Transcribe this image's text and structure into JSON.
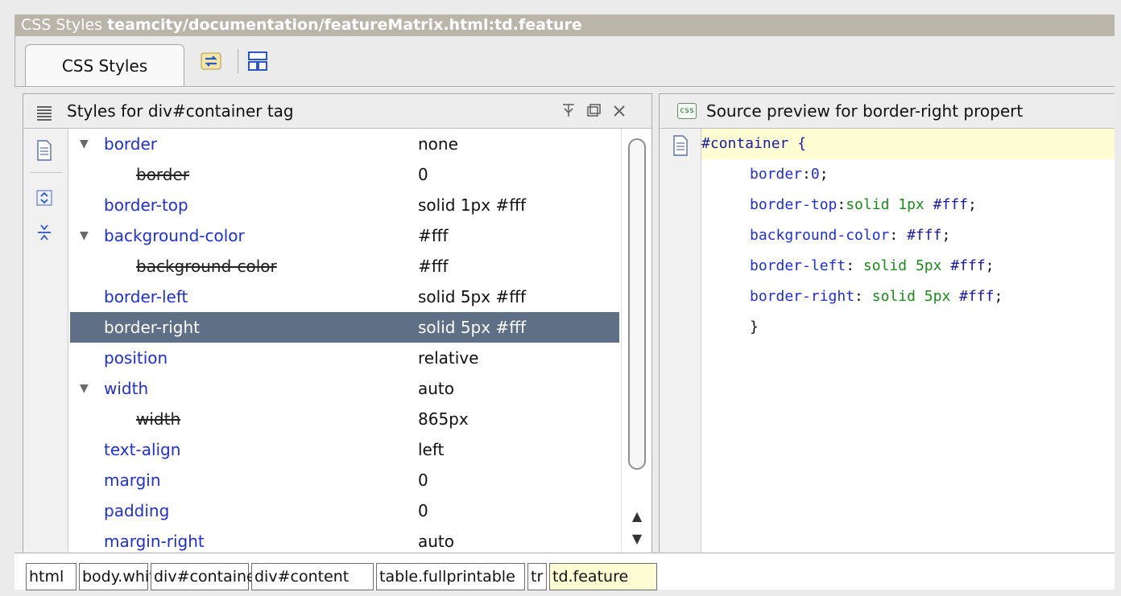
{
  "window": {
    "title_prefix": "CSS Styles ",
    "title_path": "teamcity/documentation/featureMatrix.html:td.feature"
  },
  "tabs": {
    "active_label": "CSS Styles",
    "toolbar_icons": [
      "refresh-icon",
      "layout-panels-icon"
    ]
  },
  "styles_panel": {
    "title": "Styles for div#container tag",
    "controls": [
      "pin-icon",
      "restore-icon",
      "close-icon"
    ],
    "gutter_icons": [
      "document-icon",
      "expand-all-icon",
      "collapse-all-icon"
    ],
    "rows": [
      {
        "name": "border",
        "value": "none",
        "expanded": true,
        "overridden": false,
        "selected": false
      },
      {
        "name": "border",
        "value": "0",
        "expanded": false,
        "overridden": true,
        "selected": false
      },
      {
        "name": "border-top",
        "value": "solid 1px #fff",
        "expanded": false,
        "overridden": false,
        "selected": false
      },
      {
        "name": "background-color",
        "value": "#fff",
        "expanded": true,
        "overridden": false,
        "selected": false
      },
      {
        "name": "background-color",
        "value": "#fff",
        "expanded": false,
        "overridden": true,
        "selected": false
      },
      {
        "name": "border-left",
        "value": "solid 5px #fff",
        "expanded": false,
        "overridden": false,
        "selected": false
      },
      {
        "name": "border-right",
        "value": "solid 5px #fff",
        "expanded": false,
        "overridden": false,
        "selected": true
      },
      {
        "name": "position",
        "value": "relative",
        "expanded": false,
        "overridden": false,
        "selected": false
      },
      {
        "name": "width",
        "value": "auto",
        "expanded": true,
        "overridden": false,
        "selected": false
      },
      {
        "name": "width",
        "value": "865px",
        "expanded": false,
        "overridden": true,
        "selected": false
      },
      {
        "name": "text-align",
        "value": "left",
        "expanded": false,
        "overridden": false,
        "selected": false
      },
      {
        "name": "margin",
        "value": "0",
        "expanded": false,
        "overridden": false,
        "selected": false
      },
      {
        "name": "padding",
        "value": "0",
        "expanded": false,
        "overridden": false,
        "selected": false
      },
      {
        "name": "margin-right",
        "value": "auto",
        "expanded": false,
        "overridden": false,
        "selected": false
      }
    ]
  },
  "source_panel": {
    "title": "Source preview for border-right propert",
    "css_icon_label": "css",
    "selector_line": "#container {",
    "declarations": [
      {
        "prop": "border",
        "sep": ":",
        "value": "0",
        "end": ";"
      },
      {
        "prop": "border-top",
        "sep": ":",
        "value": "solid 1px #fff",
        "end": ";"
      },
      {
        "prop": "background-color",
        "sep": ": ",
        "value": "#fff",
        "end": ";"
      },
      {
        "prop": "border-left",
        "sep": ": ",
        "value": "solid 5px #fff",
        "end": ";"
      },
      {
        "prop": "border-right",
        "sep": ": ",
        "value": "solid 5px #fff",
        "end": ";"
      }
    ],
    "closing": "}"
  },
  "breadcrumb": [
    {
      "label": "html",
      "active": false
    },
    {
      "label": "body.white",
      "active": false
    },
    {
      "label": "div#container",
      "active": false
    },
    {
      "label": "div#content",
      "active": false
    },
    {
      "label": "table.fullprintable",
      "active": false
    },
    {
      "label": "tr",
      "active": false
    },
    {
      "label": "td.feature",
      "active": true
    }
  ],
  "colors": {
    "selection": "#5f6f86",
    "property_name": "#1f2fd8",
    "highlight_line": "#fdfdd3",
    "title_bar": "#b9b5a9"
  }
}
